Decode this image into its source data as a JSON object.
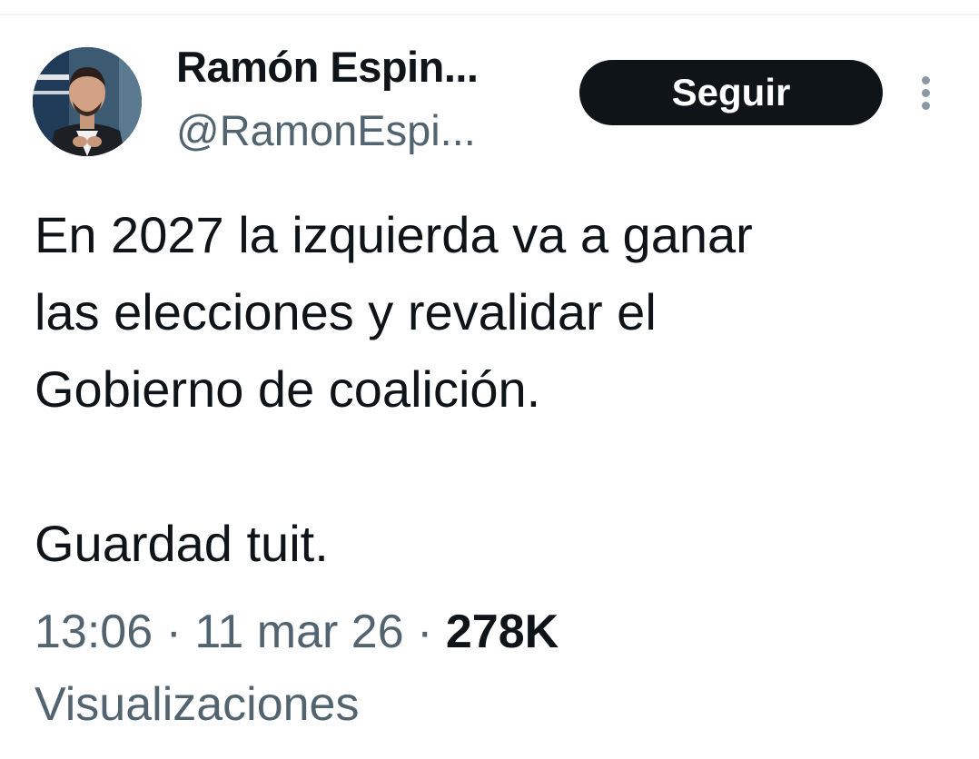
{
  "author": {
    "name": "Ramón Espin...",
    "handle": "@RamonEspi..."
  },
  "follow_button": {
    "label": "Seguir"
  },
  "more_menu": {
    "icon": "more-vertical-icon"
  },
  "tweet": {
    "text": "En 2027 la izquierda va a ganar\nlas elecciones y revalidar el\nGobierno de coalición.\n\nGuardad tuit.",
    "time": "13:06",
    "date": "11 mar 26",
    "separator": " · ",
    "views_count": "278K",
    "views_label": "Visualizaciones"
  },
  "colors": {
    "text_primary": "#0f1419",
    "text_secondary": "#536471",
    "button_bg": "#0f1419",
    "button_text": "#ffffff"
  }
}
